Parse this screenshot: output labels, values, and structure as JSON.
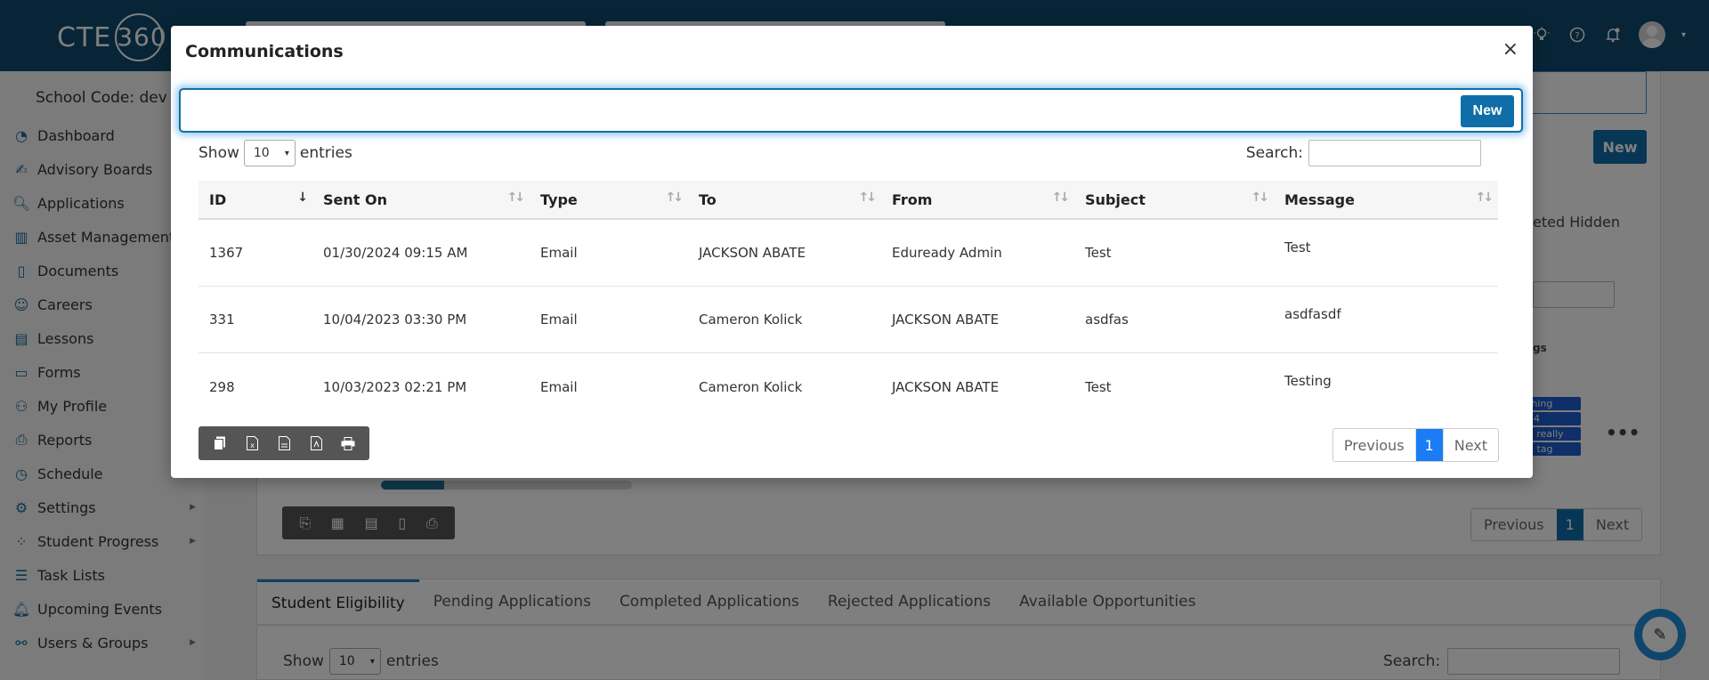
{
  "header": {
    "logo_text": "CTE",
    "logo_ring_text": "360"
  },
  "sidebar": {
    "school_code": "School Code: dev",
    "items": [
      {
        "label": "Dashboard",
        "icon": "gauge-icon"
      },
      {
        "label": "Advisory Boards",
        "icon": "signature-icon"
      },
      {
        "label": "Applications",
        "icon": "search-doc-icon"
      },
      {
        "label": "Asset Management",
        "icon": "buildings-icon"
      },
      {
        "label": "Documents",
        "icon": "document-icon"
      },
      {
        "label": "Careers",
        "icon": "people-icon"
      },
      {
        "label": "Lessons",
        "icon": "book-icon"
      },
      {
        "label": "Forms",
        "icon": "form-icon"
      },
      {
        "label": "My Profile",
        "icon": "user-icon"
      },
      {
        "label": "Reports",
        "icon": "reports-icon"
      },
      {
        "label": "Schedule",
        "icon": "clock-icon"
      },
      {
        "label": "Settings",
        "icon": "gears-icon",
        "has_submenu": true
      },
      {
        "label": "Student Progress",
        "icon": "progress-icon",
        "has_submenu": true
      },
      {
        "label": "Task Lists",
        "icon": "list-icon"
      },
      {
        "label": "Upcoming Events",
        "icon": "bell-icon"
      },
      {
        "label": "Users & Groups",
        "icon": "users-icon",
        "has_submenu": true
      }
    ]
  },
  "background": {
    "new_label": "New",
    "partial_text": "eted Hidden",
    "partial_header": "gs",
    "tags": [
      "thing",
      "24",
      "a really",
      "g tag"
    ],
    "progress_fraction": 0.25,
    "pager": {
      "previous": "Previous",
      "current": "1",
      "next": "Next"
    },
    "tabs": [
      "Student Eligibility",
      "Pending Applications",
      "Completed Applications",
      "Rejected Applications",
      "Available Opportunities"
    ],
    "show_label": "Show",
    "entries_label": "entries",
    "page_length": "10",
    "search_label": "Search:"
  },
  "modal": {
    "title": "Communications",
    "close_glyph": "×",
    "new_label": "New",
    "show_label": "Show",
    "entries_label": "entries",
    "page_length": "10",
    "search_label": "Search:",
    "columns": [
      "ID",
      "Sent On",
      "Type",
      "To",
      "From",
      "Subject",
      "Message"
    ],
    "rows": [
      {
        "id": "1367",
        "sent_on": "01/30/2024 09:15 AM",
        "type": "Email",
        "to": "JACKSON ABATE",
        "from": "Eduready Admin",
        "subject": "Test",
        "message": "Test"
      },
      {
        "id": "331",
        "sent_on": "10/04/2023 03:30 PM",
        "type": "Email",
        "to": "Cameron Kolick",
        "from": "JACKSON ABATE",
        "subject": "asdfas",
        "message": "asdfasdf"
      },
      {
        "id": "298",
        "sent_on": "10/03/2023 02:21 PM",
        "type": "Email",
        "to": "Cameron Kolick",
        "from": "JACKSON ABATE",
        "subject": "Test",
        "message": "Testing"
      }
    ],
    "export_buttons": [
      "copy-icon",
      "excel-icon",
      "csv-icon",
      "pdf-icon",
      "print-icon"
    ],
    "pager": {
      "previous": "Previous",
      "current": "1",
      "next": "Next"
    }
  },
  "colors": {
    "topbar": "#0e4a6e",
    "primary": "#0f6ea8",
    "page_active": "#1a7df5"
  }
}
